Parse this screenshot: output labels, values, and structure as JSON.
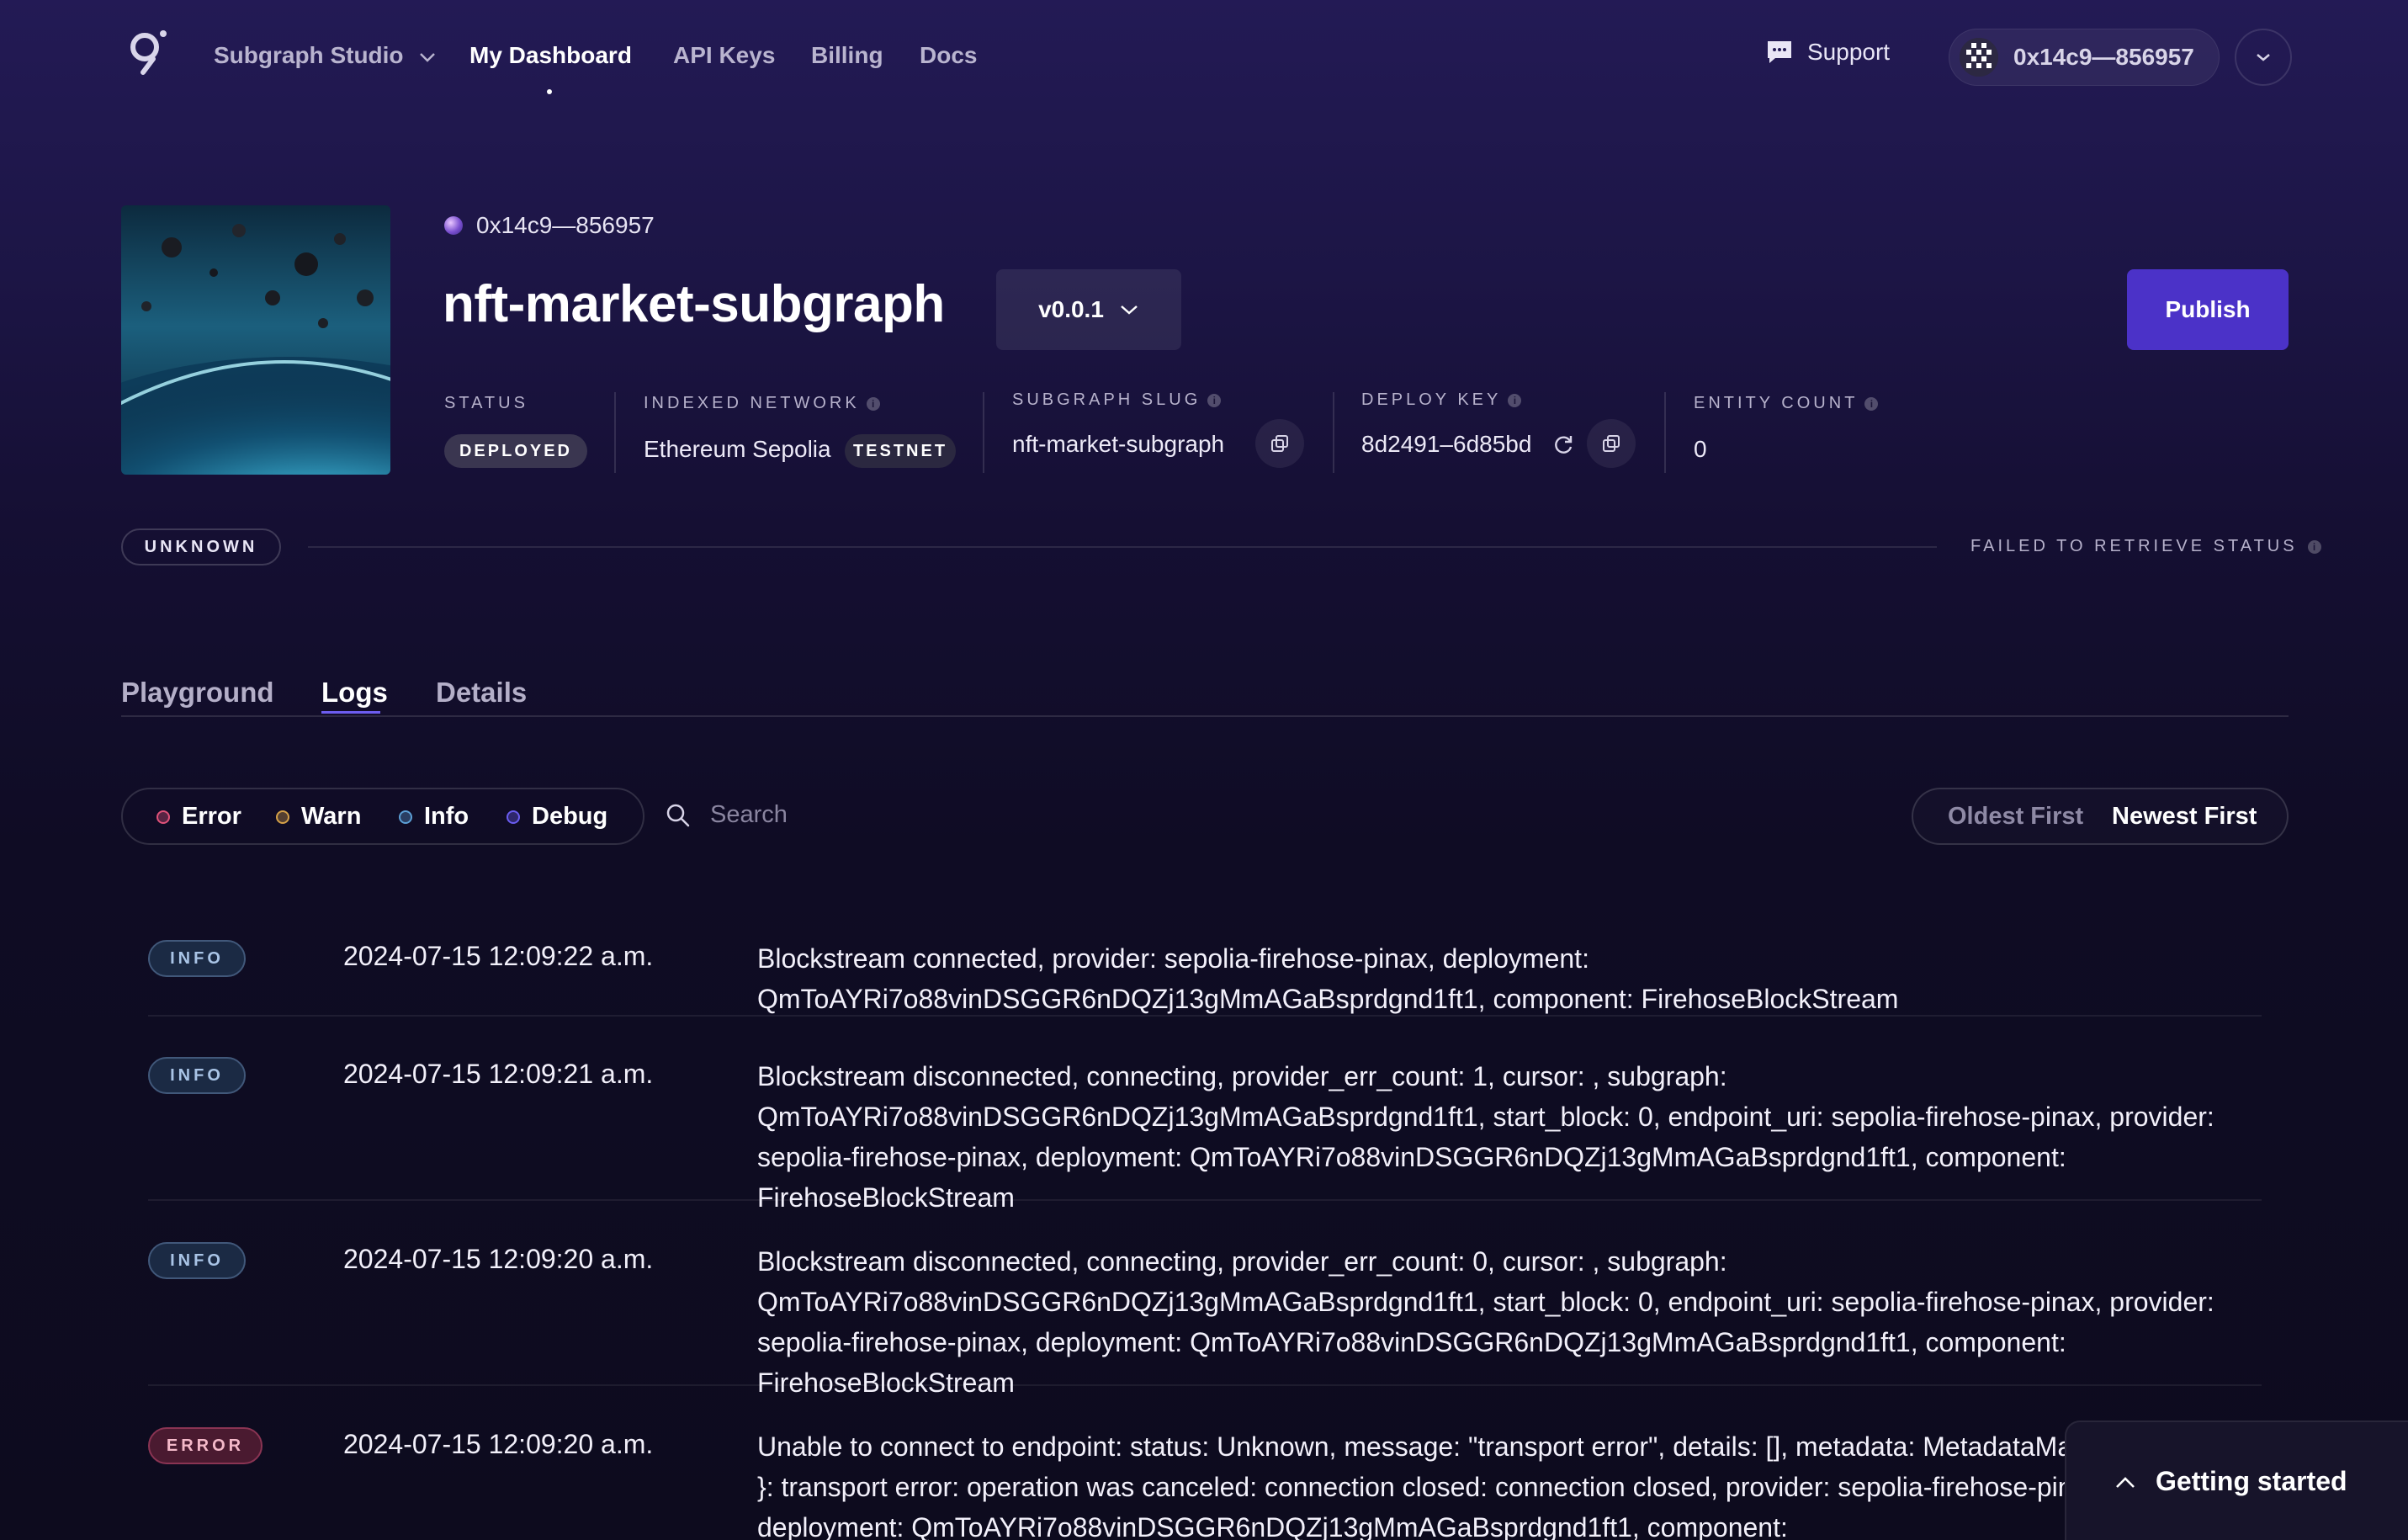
{
  "nav": {
    "app_name": "Subgraph Studio",
    "items": [
      {
        "label": "My Dashboard",
        "active": true
      },
      {
        "label": "API Keys"
      },
      {
        "label": "Billing"
      },
      {
        "label": "Docs"
      }
    ],
    "support_label": "Support",
    "account_address": "0x14c9—856957"
  },
  "subgraph": {
    "owner": "0x14c9—856957",
    "name": "nft-market-subgraph",
    "version": "v0.0.1",
    "publish_label": "Publish",
    "status_label": "STATUS",
    "status_value": "DEPLOYED",
    "network_label": "INDEXED NETWORK",
    "network_value": "Ethereum Sepolia",
    "network_tag": "TESTNET",
    "slug_label": "SUBGRAPH SLUG",
    "slug_value": "nft-market-subgraph",
    "deploy_key_label": "DEPLOY KEY",
    "deploy_key_value": "8d2491–6d85bd",
    "entity_count_label": "ENTITY COUNT",
    "entity_count_value": "0",
    "sync_badge": "UNKNOWN",
    "sync_status_text": "FAILED TO RETRIEVE STATUS"
  },
  "tabs": [
    {
      "label": "Playground"
    },
    {
      "label": "Logs",
      "active": true
    },
    {
      "label": "Details"
    }
  ],
  "filters": {
    "levels": [
      {
        "label": "Error",
        "color": "#e0527a"
      },
      {
        "label": "Warn",
        "color": "#d4a048"
      },
      {
        "label": "Info",
        "color": "#5c9fd6"
      },
      {
        "label": "Debug",
        "color": "#6a5cf0"
      }
    ],
    "search_placeholder": "Search",
    "sort_oldest": "Oldest First",
    "sort_newest": "Newest First",
    "sort_active": "Newest First"
  },
  "logs": [
    {
      "level": "INFO",
      "time": "2024-07-15 12:09:22 a.m.",
      "message": "Blockstream connected, provider: sepolia-firehose-pinax, deployment: QmToAYRi7o88vinDSGGR6nDQZj13gMmAGaBsprdgnd1ft1, component: FirehoseBlockStream"
    },
    {
      "level": "INFO",
      "time": "2024-07-15 12:09:21 a.m.",
      "message": "Blockstream disconnected, connecting, provider_err_count: 1, cursor: , subgraph: QmToAYRi7o88vinDSGGR6nDQZj13gMmAGaBsprdgnd1ft1, start_block: 0, endpoint_uri: sepolia-firehose-pinax, provider: sepolia-firehose-pinax, deployment: QmToAYRi7o88vinDSGGR6nDQZj13gMmAGaBsprdgnd1ft1, component: FirehoseBlockStream"
    },
    {
      "level": "INFO",
      "time": "2024-07-15 12:09:20 a.m.",
      "message": "Blockstream disconnected, connecting, provider_err_count: 0, cursor: , subgraph: QmToAYRi7o88vinDSGGR6nDQZj13gMmAGaBsprdgnd1ft1, start_block: 0, endpoint_uri: sepolia-firehose-pinax, provider: sepolia-firehose-pinax, deployment: QmToAYRi7o88vinDSGGR6nDQZj13gMmAGaBsprdgnd1ft1, component: FirehoseBlockStream"
    },
    {
      "level": "ERROR",
      "time": "2024-07-15 12:09:20 a.m.",
      "message": "Unable to connect to endpoint: status: Unknown, message: \"transport error\", details: [], metadata: MetadataMap { headers: {} }: transport error: operation was canceled: connection closed: connection closed, provider: sepolia-firehose-pinax, deployment: QmToAYRi7o88vinDSGGR6nDQZj13gMmAGaBsprdgnd1ft1, component:"
    }
  ],
  "getting_started_label": "Getting started"
}
